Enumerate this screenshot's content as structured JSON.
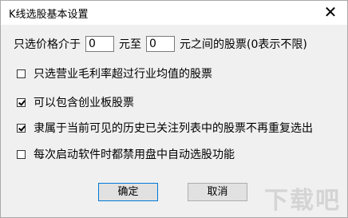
{
  "window": {
    "title": "K线选股基本设置",
    "close_glyph": "✕"
  },
  "price_filter": {
    "prefix": "只选价格介于",
    "min_value": "0",
    "middle": "元至",
    "max_value": "0",
    "suffix": "元之间的股票(0表示不限)"
  },
  "options": [
    {
      "label": "只选营业毛利率超过行业均值的股票",
      "checked": false
    },
    {
      "label": "可以包含创业板股票",
      "checked": true
    },
    {
      "label": "隶属于当前可见的历史已关注列表中的股票不再重复选出",
      "checked": true
    },
    {
      "label": "每次启动软件时都禁用盘中自动选股功能",
      "checked": false
    }
  ],
  "buttons": {
    "ok": "确定",
    "cancel": "取消"
  },
  "watermark": "下载吧"
}
